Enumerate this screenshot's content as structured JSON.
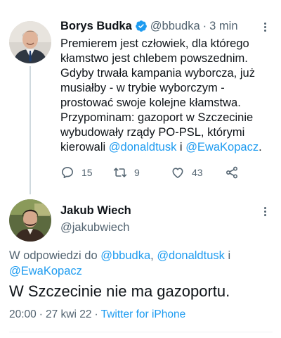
{
  "parent_tweet": {
    "author_name": "Borys Budka",
    "handle": "@bbudka",
    "separator": "·",
    "time": "3 min",
    "text_lines": [
      "Premierem jest człowiek, dla którego",
      "kłamstwo jest chlebem powszednim.",
      "Gdyby trwała kampania wyborcza, już",
      "musiałby - w trybie wyborczym -",
      "prostować swoje kolejne kłamstwa.",
      "Przypominam: gazoport w Szczecinie",
      "wybudowały rządy PO-PSL, którymi"
    ],
    "last_line_prefix": "kierowali ",
    "mention_1": "@donaldtusk",
    "last_line_middle": " i ",
    "mention_2": "@EwaKopacz",
    "last_line_suffix": ".",
    "replies": "15",
    "retweets": "9",
    "likes": "43"
  },
  "main_tweet": {
    "author_name": "Jakub Wiech",
    "handle": "@jakubwiech",
    "reply_prefix": "W odpowiedzi do ",
    "reply_mention_1": "@bbudka",
    "reply_comma": ", ",
    "reply_mention_2": "@donaldtusk",
    "reply_and": " i",
    "reply_mention_3": "@EwaKopacz",
    "text": "W Szczecinie nie ma gazoportu.",
    "time": "20:00",
    "date": "27 kwi 22",
    "separator": "·",
    "source": "Twitter for iPhone"
  },
  "icons": {
    "verified": "verified-badge-icon",
    "more": "more-dots-icon",
    "reply": "reply-bubble-icon",
    "retweet": "retweet-arrows-icon",
    "like": "heart-icon",
    "share": "share-icon"
  },
  "colors": {
    "accent": "#1d9bf0",
    "text": "#0f1419",
    "muted": "#536471",
    "thread_line": "#cfd9de"
  }
}
